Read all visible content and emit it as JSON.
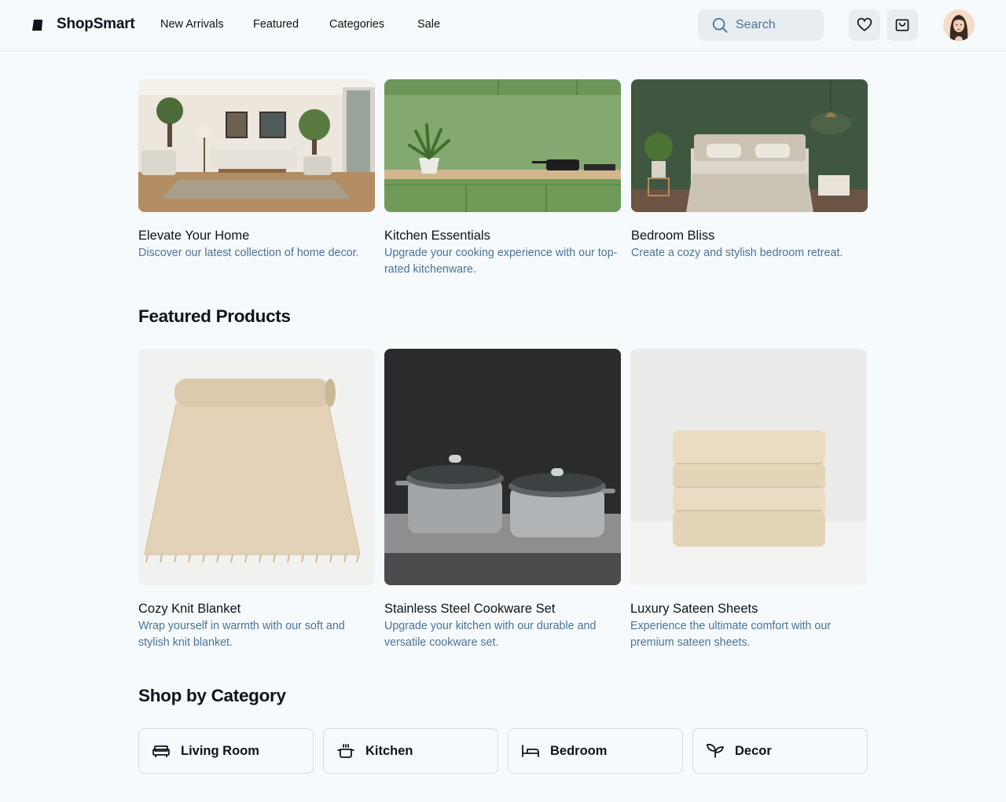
{
  "header": {
    "brand": "ShopSmart",
    "logo_icon": "brand-logo-icon",
    "nav": [
      "New Arrivals",
      "Featured",
      "Categories",
      "Sale"
    ],
    "search_placeholder": "Search",
    "search_icon": "search-icon",
    "wishlist_icon": "heart-icon",
    "cart_icon": "shopping-bag-icon",
    "avatar": "user-avatar"
  },
  "hero_cards": [
    {
      "title": "Elevate Your Home",
      "description": "Discover our latest collection of home decor.",
      "image": "living-room-photo"
    },
    {
      "title": "Kitchen Essentials",
      "description": "Upgrade your cooking experience with our top-rated kitchenware.",
      "image": "green-kitchen-photo"
    },
    {
      "title": "Bedroom Bliss",
      "description": "Create a cozy and stylish bedroom retreat.",
      "image": "bedroom-photo"
    }
  ],
  "featured": {
    "title": "Featured Products",
    "products": [
      {
        "title": "Cozy Knit Blanket",
        "description": "Wrap yourself in warmth with our soft and stylish knit blanket.",
        "image": "knit-blanket-photo"
      },
      {
        "title": "Stainless Steel Cookware Set",
        "description": "Upgrade your kitchen with our durable and versatile cookware set.",
        "image": "cookware-photo"
      },
      {
        "title": "Luxury Sateen Sheets",
        "description": "Experience the ultimate comfort with our premium sateen sheets.",
        "image": "sateen-sheets-photo"
      }
    ]
  },
  "categories": {
    "title": "Shop by Category",
    "items": [
      {
        "label": "Living Room",
        "icon": "sofa-icon"
      },
      {
        "label": "Kitchen",
        "icon": "cooking-pot-icon"
      },
      {
        "label": "Bedroom",
        "icon": "bed-icon"
      },
      {
        "label": "Decor",
        "icon": "plant-icon"
      }
    ]
  },
  "colors": {
    "background": "#f7fafc",
    "text": "#0d141c",
    "muted_text": "#4a739c",
    "input_bg": "#e8edf2",
    "border": "#d0dbe7"
  }
}
